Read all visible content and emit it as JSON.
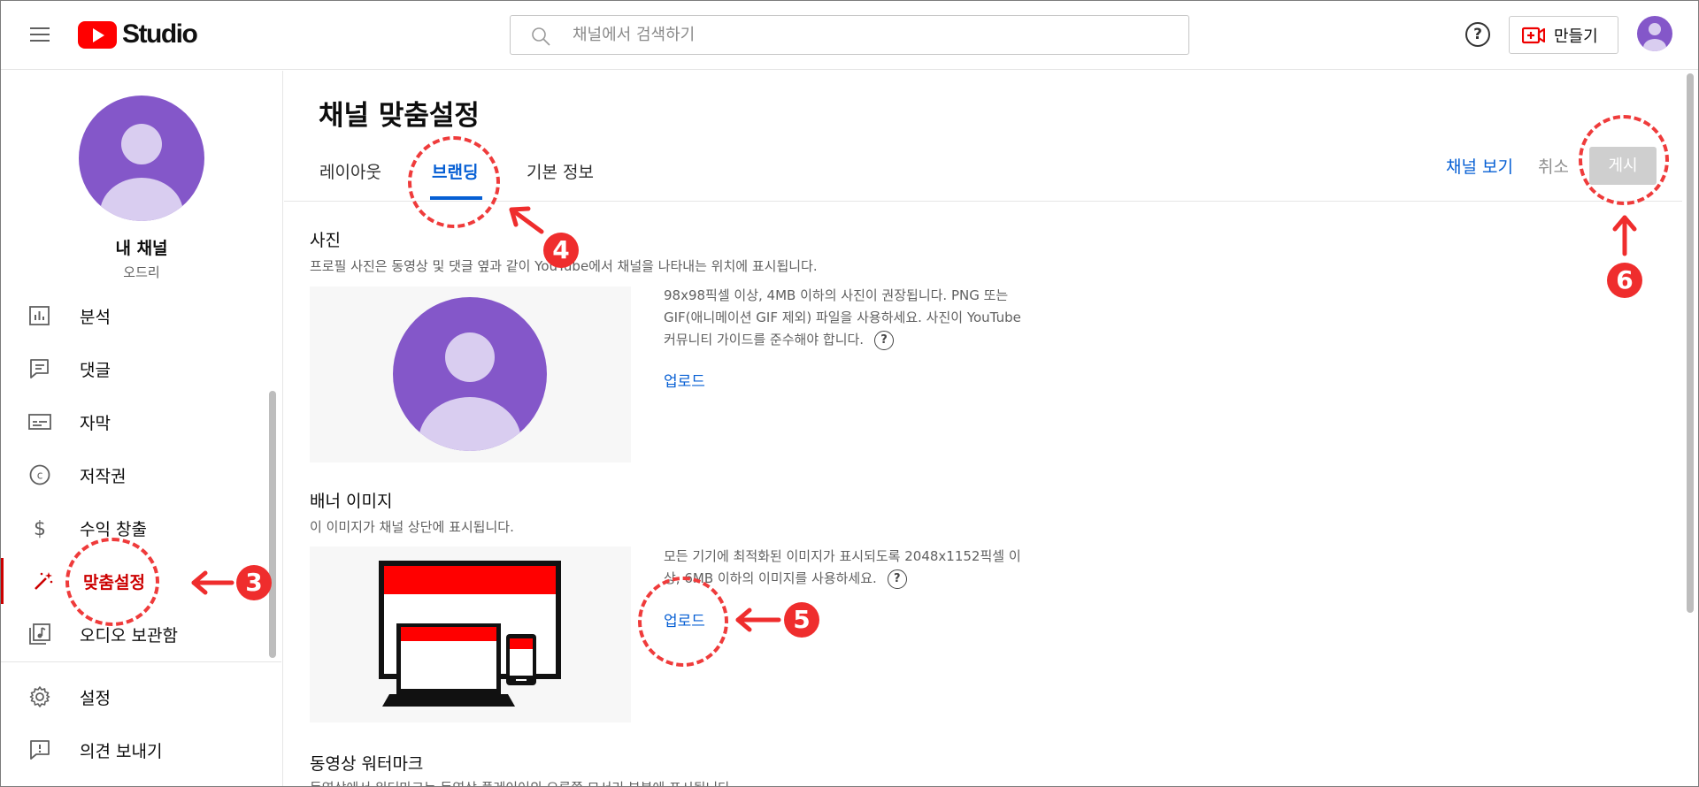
{
  "header": {
    "logo_text": "Studio",
    "search_placeholder": "채널에서 검색하기",
    "help_symbol": "?",
    "create_label": "만들기",
    "icons": [
      "menu-icon",
      "search-icon",
      "help-icon",
      "create-video-icon",
      "avatar"
    ]
  },
  "sidebar": {
    "channel_title": "내 채널",
    "channel_subtitle": "오드리",
    "items": [
      {
        "label": "분석",
        "icon": "analytics-icon"
      },
      {
        "label": "댓글",
        "icon": "comments-icon"
      },
      {
        "label": "자막",
        "icon": "subtitles-icon"
      },
      {
        "label": "저작권",
        "icon": "copyright-icon"
      },
      {
        "label": "수익 창출",
        "icon": "monetization-icon"
      },
      {
        "label": "맞춤설정",
        "icon": "customization-icon",
        "active": true
      },
      {
        "label": "오디오 보관함",
        "icon": "audio-library-icon"
      },
      {
        "label": "설정",
        "icon": "settings-icon"
      },
      {
        "label": "의견 보내기",
        "icon": "feedback-icon"
      }
    ]
  },
  "main": {
    "page_title": "채널 맞춤설정",
    "tabs": [
      {
        "label": "레이아웃"
      },
      {
        "label": "브랜딩",
        "active": true
      },
      {
        "label": "기본 정보"
      }
    ],
    "view_channel_label": "채널 보기",
    "cancel_label": "취소",
    "publish_label": "게시",
    "photo": {
      "title": "사진",
      "description": "프로필 사진은 동영상 및 댓글 옆과 같이 YouTube에서 채널을 나타내는 위치에 표시됩니다.",
      "info": "98x98픽셀 이상, 4MB 이하의 사진이 권장됩니다. PNG 또는 GIF(애니메이션 GIF 제외) 파일을 사용하세요. 사진이 YouTube 커뮤니티 가이드를 준수해야 합니다.",
      "upload_label": "업로드"
    },
    "banner": {
      "title": "배너 이미지",
      "description": "이 이미지가 채널 상단에 표시됩니다.",
      "info": "모든 기기에 최적화된 이미지가 표시되도록 2048x1152픽셀 이상, 6MB 이하의 이미지를 사용하세요.",
      "upload_label": "업로드"
    },
    "watermark": {
      "title": "동영상 워터마크",
      "description": "동영상에서 워터마크는 동영상 플레이어의 오른쪽 모서리 부분에 표시됩니다."
    }
  },
  "annotations": {
    "step3": "3",
    "step4": "4",
    "step5": "5",
    "step6": "6",
    "color": "#ef2d2d"
  }
}
